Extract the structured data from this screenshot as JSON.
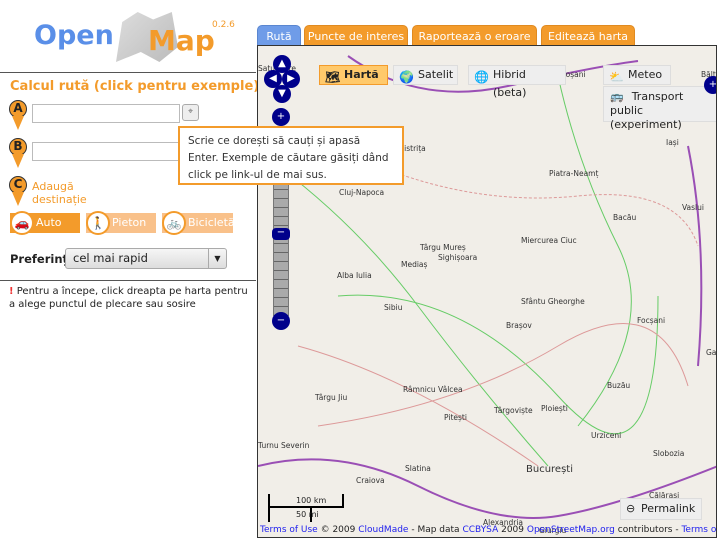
{
  "logo": {
    "text_open": "Open",
    "text_map": "Map",
    "version": "0.2.6"
  },
  "route": {
    "title": "Calcul rută (click pentru exemple)",
    "pin_a": "A",
    "pin_b": "B",
    "pin_c": "C",
    "input_a": "",
    "input_b": "",
    "locate_icon": "crosshair-icon",
    "add_destination": "Adaugă destinație",
    "tooltip": "Scrie ce dorești să cauți și apasă Enter. Exemple de căutare găsiți dând click pe link-ul de mai sus.",
    "modes": [
      {
        "label": "Auto",
        "icon": "car-icon",
        "selected": true
      },
      {
        "label": "Pieton",
        "icon": "pedestrian-icon"
      },
      {
        "label": "Bicicletă",
        "icon": "bicycle-icon"
      }
    ],
    "preferences_label": "Preferințe",
    "preferences_value": "cel mai rapid",
    "hint_mark": "!",
    "hint": " Pentru a începe, click dreapta pe harta pentru a alege punctul de plecare sau sosire"
  },
  "tabs": [
    {
      "label": "Rută",
      "active": true
    },
    {
      "label": "Puncte de interes"
    },
    {
      "label": "Raportează o eroare"
    },
    {
      "label": "Editează harta"
    }
  ],
  "map": {
    "layers": [
      {
        "label": "Hartă",
        "selected": true
      },
      {
        "label": "Satelit"
      },
      {
        "label": "Hibrid (beta)"
      },
      {
        "label": "Meteo"
      },
      {
        "label": "Transport public (experiment)"
      }
    ],
    "cities": [
      "Botoșani",
      "Bălți",
      "Iași",
      "Bistrița",
      "Piatra-Neamț",
      "Cluj-Napoca",
      "Bacău",
      "Vaslui",
      "Târgu Mureș",
      "Miercurea Ciuc",
      "Sighișoara",
      "Mediaș",
      "Alba Iulia",
      "Sfântu Gheorghe",
      "Sibiu",
      "Brașov",
      "Focșani",
      "Galați",
      "Târgu Jiu",
      "Râmnicu Vâlcea",
      "Buzău",
      "Pitești",
      "Târgoviște",
      "Ploiești",
      "Urziceni",
      "Turnu Severin",
      "Slobozia",
      "Craiova",
      "Slatina",
      "București",
      "Călărași",
      "Alexandria",
      "Giurgiu",
      "Satu Mare"
    ],
    "scale_km": "100 km",
    "scale_mi": "50 mi",
    "permalink": "Permalink",
    "attribution": {
      "terms1": "Terms of Use",
      "c1": " © 2009 ",
      "cloudmade": "CloudMade",
      "c2": " - Map data ",
      "ccbysa": "CCBYSA",
      "c3": " 2009 ",
      "osm": "OpenStreetMap.org",
      "c4": " contributors - ",
      "terms2": "Terms of Use"
    }
  },
  "colors": {
    "accent": "#f39b2b",
    "tab_active": "#6f9ce8",
    "nav": "#00008b"
  }
}
